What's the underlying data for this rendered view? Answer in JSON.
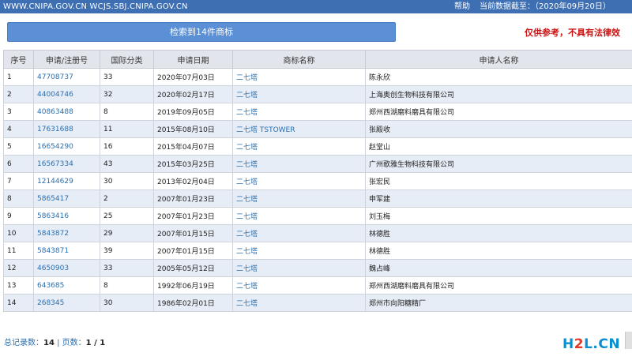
{
  "topbar": {
    "domains": "WWW.CNIPA.GOV.CN WCJS.SBJ.CNIPA.GOV.CN",
    "help": "帮助",
    "update": "当前数据截至：（2020年09月20日）"
  },
  "result_bar": {
    "label": "检索到14件商标"
  },
  "disclaimer": "仅供参考，不具有法律效",
  "table": {
    "headers": [
      "序号",
      "申请/注册号",
      "国际分类",
      "申请日期",
      "商标名称",
      "申请人名称"
    ],
    "rows": [
      [
        "1",
        "47708737",
        "33",
        "2020年07月03日",
        "二七塔",
        "陈永欣"
      ],
      [
        "2",
        "44004746",
        "32",
        "2020年02月17日",
        "二七塔",
        "上海奥创生物科技有限公司"
      ],
      [
        "3",
        "40863488",
        "8",
        "2019年09月05日",
        "二七塔",
        "郑州西湖磨料磨具有限公司"
      ],
      [
        "4",
        "17631688",
        "11",
        "2015年08月10日",
        "二七塔 TSTOWER",
        "张殿收"
      ],
      [
        "5",
        "16654290",
        "16",
        "2015年04月07日",
        "二七塔",
        "赵堂山"
      ],
      [
        "6",
        "16567334",
        "43",
        "2015年03月25日",
        "二七塔",
        "广州歌雅生物科技有限公司"
      ],
      [
        "7",
        "12144629",
        "30",
        "2013年02月04日",
        "二七塔",
        "张宏民"
      ],
      [
        "8",
        "5865417",
        "2",
        "2007年01月23日",
        "二七塔",
        "申军建"
      ],
      [
        "9",
        "5863416",
        "25",
        "2007年01月23日",
        "二七塔",
        "刘玉梅"
      ],
      [
        "10",
        "5843872",
        "29",
        "2007年01月15日",
        "二七塔",
        "林德胜"
      ],
      [
        "11",
        "5843871",
        "39",
        "2007年01月15日",
        "二七塔",
        "林德胜"
      ],
      [
        "12",
        "4650903",
        "33",
        "2005年05月12日",
        "二七塔",
        "魏占峰"
      ],
      [
        "13",
        "643685",
        "8",
        "1992年06月19日",
        "二七塔",
        "郑州西湖磨料磨具有限公司"
      ],
      [
        "14",
        "268345",
        "30",
        "1986年02月01日",
        "二七塔",
        "郑州市向阳糖精厂"
      ]
    ]
  },
  "footer": {
    "total_label": "总记录数：",
    "total_value": "14",
    "sep": " | ",
    "pages_label": "页数：",
    "pages_value": "1 / 1"
  },
  "watermark": {
    "h": "H",
    "two": "2",
    "l": "L",
    "cn": ".CN"
  }
}
